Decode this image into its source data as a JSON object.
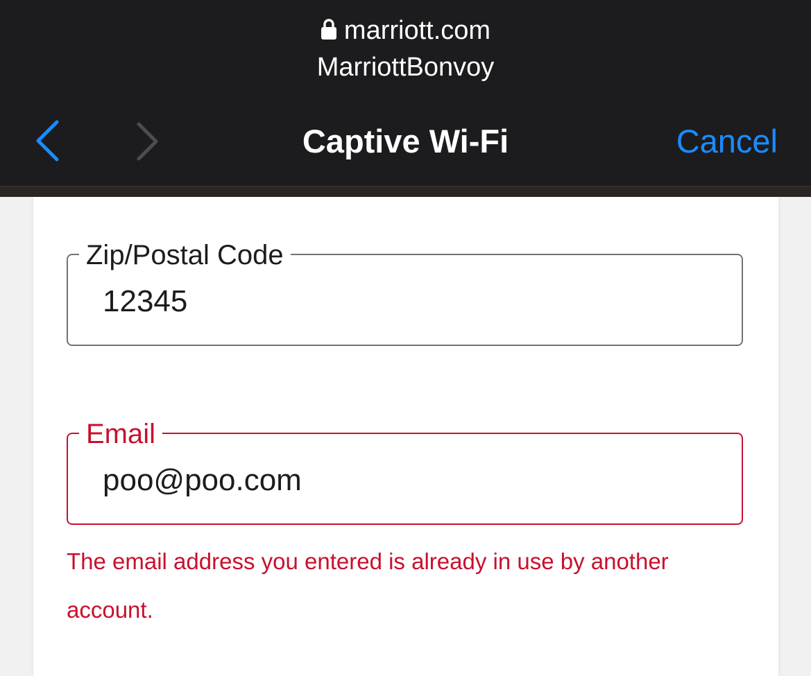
{
  "browser": {
    "domain": "marriott.com",
    "site_title": "MarriottBonvoy",
    "nav_title": "Captive Wi-Fi",
    "cancel_label": "Cancel",
    "colors": {
      "bar_background": "#1c1c1e",
      "accent": "#1a8cff"
    }
  },
  "form": {
    "zip": {
      "label": "Zip/Postal Code",
      "value": "12345"
    },
    "email": {
      "label": "Email",
      "value": "poo@poo.com",
      "error": "The email address you entered is already in use by another account.",
      "error_color": "#c8102e"
    }
  }
}
